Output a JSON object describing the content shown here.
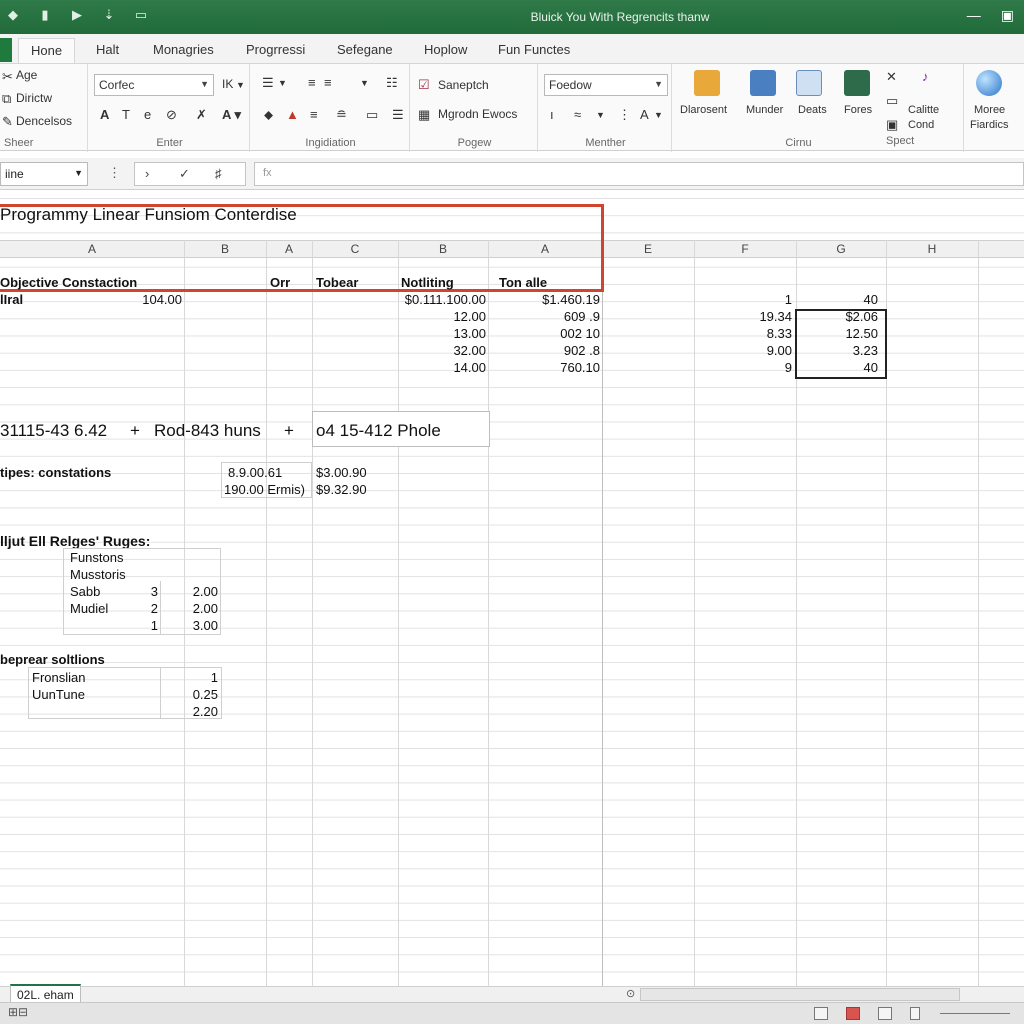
{
  "window": {
    "title": "Bluick You With Regrencits thanw"
  },
  "quick_access": [
    "save-icon",
    "undo-icon",
    "redo-icon",
    "customize-icon"
  ],
  "ribbon_tabs": [
    "Hone",
    "Halt",
    "Monagries",
    "Progrressi",
    "Sefegane",
    "Hoplow",
    "Fun Functes"
  ],
  "clipboard": {
    "items": [
      "Age",
      "Dirictw",
      "Dencelsos"
    ],
    "label": "Sheer"
  },
  "font_group": {
    "font_name": "Corfec",
    "font_size": "IK",
    "label": "Enter"
  },
  "alignment_group": {
    "label": "Ingidiation"
  },
  "wrap_group": {
    "item1": "Saneptch",
    "item2": "Mgrodn Ewocs",
    "label": "Pogew"
  },
  "number_group": {
    "format": "Foedow",
    "label": "Menther"
  },
  "cells_group": {
    "btn1": "Dlarosent",
    "btn2": "Munder",
    "btn3": "Deats",
    "btn4": "Fores",
    "btn5a": "Calitte",
    "btn5b": "Cond",
    "label": "Cirnu"
  },
  "spect_group": {
    "btn": "Moree",
    "btn_sub": "Fiardics",
    "label": "Spect"
  },
  "formula_bar": {
    "name_box": "iine",
    "formula": "fx"
  },
  "columns": [
    "A",
    "B",
    "A",
    "C",
    "B",
    "A",
    "E",
    "F",
    "G",
    "H"
  ],
  "sheet": {
    "title": "Programmy Linear Funsiom Conterdise",
    "hdr_left": "Objective Constaction",
    "hdr_orr": "Orr",
    "hdr_tobear": "Tobear",
    "hdr_notliting": "Notliting",
    "hdr_tonalle": "Ton alle",
    "row1_label": "lIral",
    "row1_val": "104.00",
    "col_d": [
      "$0.111.100.00",
      "12.00",
      "13.00",
      "32.00",
      "14.00"
    ],
    "col_e": [
      "$1.460.19",
      "609 .9",
      "002 10",
      "902 .8",
      "760.10"
    ],
    "col_f": [
      "1",
      "19.34",
      "8.33",
      "9.00",
      "9"
    ],
    "col_g": [
      "40",
      "$2.06",
      "12.50",
      "3.23",
      "40"
    ],
    "equation_left": "31115-43 6.42",
    "plus1": "+",
    "equation_mid": "Rod-843 huns",
    "plus2": "+",
    "equation_right": "o4 15-412 Phole",
    "constraints_label": "tipes: constations",
    "c_val1": "8.9.00.61",
    "c_val2": "190.00 Ermis)",
    "c_val3": "$3.00.90",
    "c_val4": "$9.32.90",
    "adjust_label": "lljut Ell Relges' Ruges:",
    "adj_rows": [
      {
        "name": "Funstons",
        "n": "",
        "v": ""
      },
      {
        "name": "Musstoris",
        "n": "",
        "v": ""
      },
      {
        "name": "Sabb",
        "n": "3",
        "v": "2.00"
      },
      {
        "name": "Mudiel",
        "n": "2",
        "v": "2.00"
      },
      {
        "name": "",
        "n": "1",
        "v": "3.00"
      }
    ],
    "solutions_label": "beprear soltlions",
    "sol_rows": [
      {
        "name": "Fronslian",
        "v": "1"
      },
      {
        "name": "UunTune",
        "v": "0.25"
      },
      {
        "name": "",
        "v": "2.20"
      }
    ]
  },
  "sheet_tab": "02L. eham",
  "colors": {
    "title_bar": "#216b3b",
    "accent_red": "#d0452f",
    "grid_line": "#e2e2e2"
  }
}
